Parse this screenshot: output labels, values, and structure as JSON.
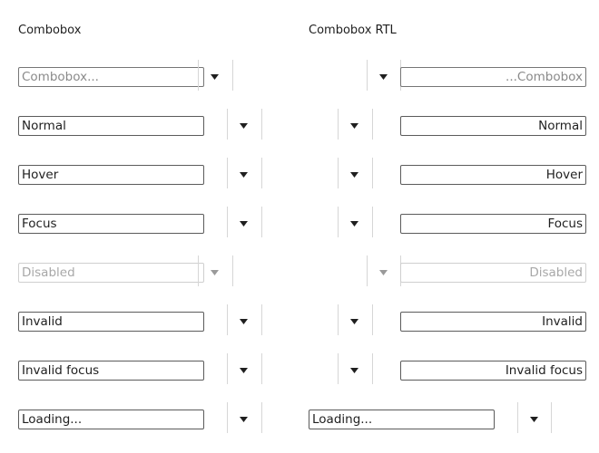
{
  "columns": {
    "ltr_title": "Combobox",
    "rtl_title": "Combobox RTL"
  },
  "rows": [
    {
      "ltr_value": "Combobox...",
      "rtl_value": "...Combobox",
      "state": "placeholder"
    },
    {
      "ltr_value": "Normal",
      "rtl_value": "Normal",
      "state": "normal"
    },
    {
      "ltr_value": "Hover",
      "rtl_value": "Hover",
      "state": "hover"
    },
    {
      "ltr_value": "Focus",
      "rtl_value": "Focus",
      "state": "focus"
    },
    {
      "ltr_value": "Disabled",
      "rtl_value": "Disabled",
      "state": "disabled"
    },
    {
      "ltr_value": "Invalid",
      "rtl_value": "Invalid",
      "state": "invalid"
    },
    {
      "ltr_value": "Invalid focus",
      "rtl_value": "Invalid focus",
      "state": "invalid-focus"
    },
    {
      "ltr_value": "Loading...",
      "rtl_value": "Loading...",
      "state": "loading"
    }
  ],
  "icons": {
    "dropdown": "caret-down-icon"
  }
}
